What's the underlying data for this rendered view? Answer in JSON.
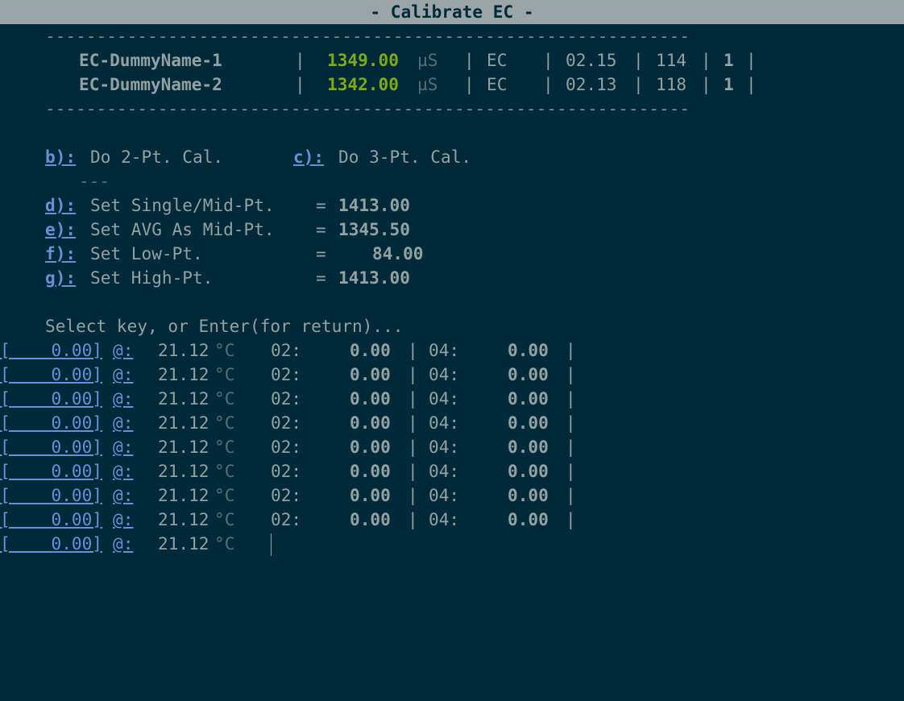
{
  "title": "- Calibrate EC -",
  "separator": "---------------------------------------------------------------",
  "sensors": [
    {
      "name": "EC-DummyName-1",
      "value": "1349.00",
      "unit": "µS",
      "type": "EC",
      "ver": "02.15",
      "num": "114",
      "flag": "1"
    },
    {
      "name": "EC-DummyName-2",
      "value": "1342.00",
      "unit": "µS",
      "type": "EC",
      "ver": "02.13",
      "num": "118",
      "flag": "1"
    }
  ],
  "menu": {
    "b_key": "b):",
    "b_label": "Do 2-Pt. Cal.",
    "c_key": "c):",
    "c_label": "Do 3-Pt. Cal.",
    "divider": "---",
    "items": [
      {
        "key": "d):",
        "label": "Set Single/Mid-Pt.",
        "eq": "=",
        "value": "1413.00"
      },
      {
        "key": "e):",
        "label": "Set AVG As Mid-Pt.",
        "eq": "=",
        "value": "1345.50"
      },
      {
        "key": "f):",
        "label": "Set Low-Pt.",
        "eq": "=",
        "value": "84.00"
      },
      {
        "key": "g):",
        "label": "Set High-Pt.",
        "eq": "=",
        "value": "1413.00"
      }
    ]
  },
  "prompt": "Select key, or Enter(for return)...",
  "readings": [
    {
      "val": "[    0.00]",
      "at": "@:",
      "temp": "21.12",
      "deg": "°C",
      "l1": "02:",
      "v1": "0.00",
      "l2": "04:",
      "v2": "0.00"
    },
    {
      "val": "[    0.00]",
      "at": "@:",
      "temp": "21.12",
      "deg": "°C",
      "l1": "02:",
      "v1": "0.00",
      "l2": "04:",
      "v2": "0.00"
    },
    {
      "val": "[    0.00]",
      "at": "@:",
      "temp": "21.12",
      "deg": "°C",
      "l1": "02:",
      "v1": "0.00",
      "l2": "04:",
      "v2": "0.00"
    },
    {
      "val": "[    0.00]",
      "at": "@:",
      "temp": "21.12",
      "deg": "°C",
      "l1": "02:",
      "v1": "0.00",
      "l2": "04:",
      "v2": "0.00"
    },
    {
      "val": "[    0.00]",
      "at": "@:",
      "temp": "21.12",
      "deg": "°C",
      "l1": "02:",
      "v1": "0.00",
      "l2": "04:",
      "v2": "0.00"
    },
    {
      "val": "[    0.00]",
      "at": "@:",
      "temp": "21.12",
      "deg": "°C",
      "l1": "02:",
      "v1": "0.00",
      "l2": "04:",
      "v2": "0.00"
    },
    {
      "val": "[    0.00]",
      "at": "@:",
      "temp": "21.12",
      "deg": "°C",
      "l1": "02:",
      "v1": "0.00",
      "l2": "04:",
      "v2": "0.00"
    },
    {
      "val": "[    0.00]",
      "at": "@:",
      "temp": "21.12",
      "deg": "°C",
      "l1": "02:",
      "v1": "0.00",
      "l2": "04:",
      "v2": "0.00"
    }
  ],
  "last_reading": {
    "val": "[    0.00]",
    "at": "@:",
    "temp": "21.12",
    "deg": "°C"
  },
  "colors": {
    "background": "#00293a",
    "title_bar": "#9aa5a7",
    "value_green": "#7eab13",
    "key_blue": "#6c8ed6"
  }
}
